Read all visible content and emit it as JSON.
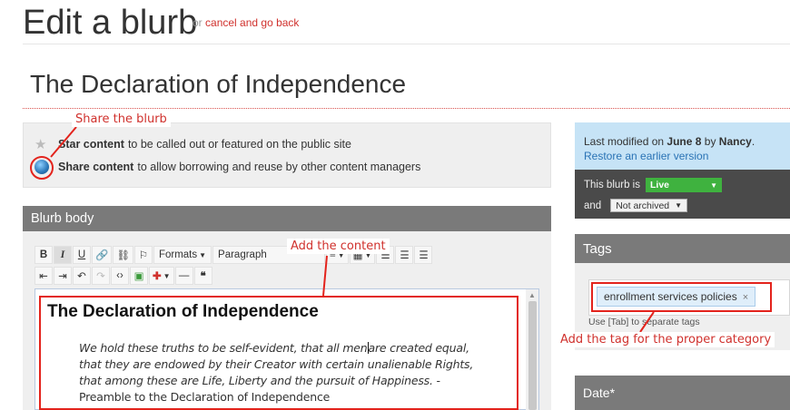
{
  "header": {
    "title": "Edit a blurb",
    "cancel_prefix": "or",
    "cancel_link": "cancel and go back"
  },
  "blurb": {
    "title": "The Declaration of Independence"
  },
  "share_panel": {
    "star_bold": "Star content",
    "star_text": "to be called out or featured on the public site",
    "share_bold": "Share content",
    "share_text": "to allow borrowing and reuse by other content managers"
  },
  "body_section": {
    "header": "Blurb body",
    "toolbar": {
      "row1": [
        "B",
        "I",
        "U",
        "link",
        "unlink",
        "anchor",
        "Formats",
        "Paragraph",
        "table",
        "align-left",
        "align-center",
        "align-right"
      ],
      "formats_label": "Formats",
      "paragraph_label": "Paragraph",
      "quote_glyph": "66"
    },
    "editor": {
      "heading": "The Declaration of Independence",
      "quote_before_cursor": "We hold these truths to be self-evident, that all men",
      "quote_after_cursor": "are created equal, that they are endowed by their Creator with certain unalienable Rights, that among these are Life, Liberty and the pursuit of Happiness.",
      "attribution": " -  Preamble to the Declaration of Independence"
    }
  },
  "info_box": {
    "modified_prefix": "Last modified on",
    "modified_date": "June 8",
    "modified_by": "by",
    "modified_user": "Nancy",
    "modified_suffix": ".",
    "restore_link": "Restore an earlier version"
  },
  "status_box": {
    "is_label": "This blurb is",
    "live_value": "Live",
    "and_label": "and",
    "archived_value": "Not archived"
  },
  "tags_section": {
    "header": "Tags",
    "tag": "enrollment services policies",
    "remove_glyph": "×",
    "hint": "Use [Tab] to separate tags"
  },
  "date_section": {
    "header": "Date*"
  },
  "annotations": {
    "share": "Share the blurb",
    "content": "Add the content",
    "tag": "Add the tag for the proper category"
  },
  "colors": {
    "annotation": "#e3231c",
    "live": "#3fb23f",
    "link": "#d0312d",
    "info_bg": "#c6e3f6"
  }
}
